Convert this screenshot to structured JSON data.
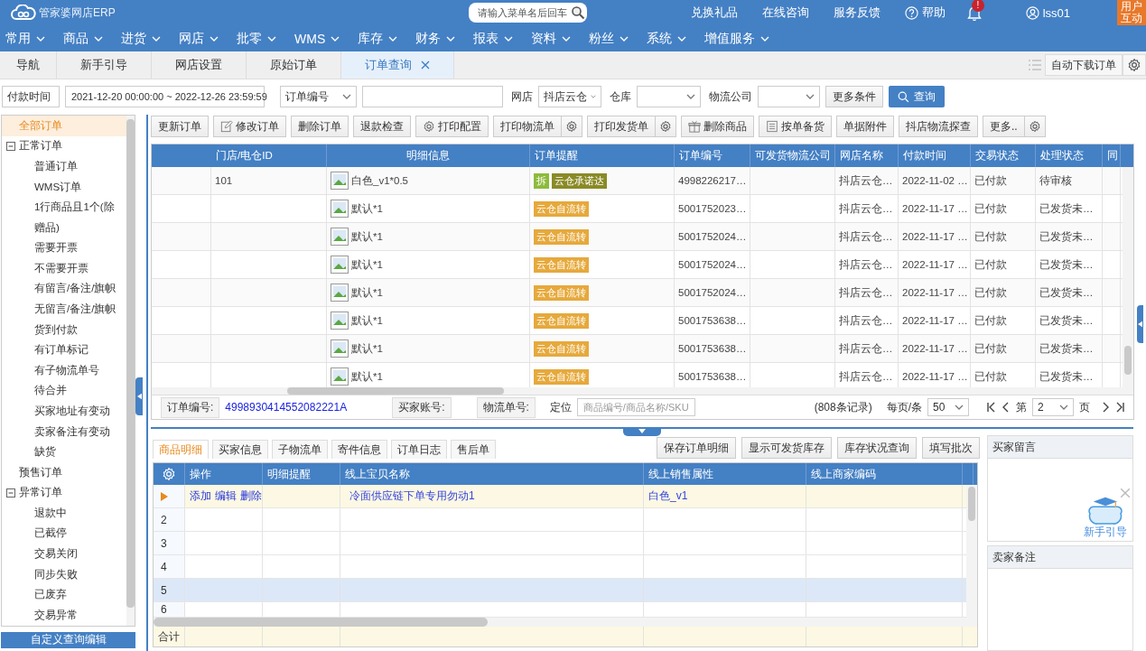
{
  "header": {
    "logo": "管家婆网店ERP",
    "search_placeholder": "请输入菜单名后回车",
    "links": [
      "兑换礼品",
      "在线咨询",
      "服务反馈"
    ],
    "help": "帮助",
    "notification_badge": "!",
    "user": "lss01",
    "user_interaction": "用户互动"
  },
  "menu": [
    "常用",
    "商品",
    "进货",
    "网店",
    "批零",
    "WMS",
    "库存",
    "财务",
    "报表",
    "资料",
    "粉丝",
    "系统",
    "增值服务"
  ],
  "tabs": [
    {
      "label": "导航",
      "selected": false,
      "closable": false
    },
    {
      "label": "新手引导",
      "selected": false,
      "closable": false
    },
    {
      "label": "网店设置",
      "selected": false,
      "closable": false
    },
    {
      "label": "原始订单",
      "selected": false,
      "closable": false
    },
    {
      "label": "订单查询",
      "selected": true,
      "closable": true
    }
  ],
  "auto_download": "自动下载订单",
  "filters": {
    "time_type": "付款时间",
    "date_range": "2021-12-20 00:00:00 ~ 2022-12-26 23:59:59",
    "order_field": "订单编号",
    "shop_label": "网店",
    "shop": "抖店云仓",
    "warehouse_label": "仓库",
    "logistics_label": "物流公司",
    "more_button": "更多条件",
    "search_button": "查询"
  },
  "sidebar": {
    "items": [
      {
        "label": "全部订单",
        "selected": true
      },
      {
        "label": "正常订单",
        "selected": false,
        "expanded": true,
        "children": [
          {
            "label": "普通订单",
            "selected": false
          },
          {
            "label": "WMS订单",
            "selected": false
          },
          {
            "label": "1行商品且1个(除赠品)",
            "selected": false
          },
          {
            "label": "需要开票",
            "selected": false
          },
          {
            "label": "不需要开票",
            "selected": false
          },
          {
            "label": "有留言/备注/旗帜",
            "selected": false
          },
          {
            "label": "无留言/备注/旗帜",
            "selected": false
          },
          {
            "label": "货到付款",
            "selected": false
          },
          {
            "label": "有订单标记",
            "selected": false
          },
          {
            "label": "有子物流单号",
            "selected": false
          },
          {
            "label": "待合并",
            "selected": false
          },
          {
            "label": "买家地址有变动",
            "selected": false
          },
          {
            "label": "卖家备注有变动",
            "selected": false
          },
          {
            "label": "缺货",
            "selected": false
          }
        ]
      },
      {
        "label": "预售订单",
        "selected": false
      },
      {
        "label": "异常订单",
        "selected": false,
        "expanded": true,
        "children": [
          {
            "label": "退款中",
            "selected": false
          },
          {
            "label": "已截停",
            "selected": false
          },
          {
            "label": "交易关闭",
            "selected": false
          },
          {
            "label": "同步失败",
            "selected": false
          },
          {
            "label": "已废弃",
            "selected": false
          },
          {
            "label": "交易异常",
            "selected": false
          }
        ]
      }
    ],
    "custom_query_button": "自定义查询编辑"
  },
  "toolbar": [
    {
      "label": "更新订单",
      "kind": "plain",
      "settings": false
    },
    {
      "label": "修改订单",
      "kind": "edit",
      "settings": false
    },
    {
      "label": "删除订单",
      "kind": "plain",
      "settings": false
    },
    {
      "label": "退款检查",
      "kind": "plain",
      "settings": false
    },
    {
      "label": "打印配置",
      "kind": "config",
      "settings": false
    },
    {
      "label": "打印物流单",
      "kind": "plain",
      "settings": true
    },
    {
      "label": "打印发货单",
      "kind": "plain",
      "settings": true
    },
    {
      "label": "删除商品",
      "kind": "remove",
      "settings": false
    },
    {
      "label": "按单备货",
      "kind": "stock",
      "settings": false
    },
    {
      "label": "单据附件",
      "kind": "plain",
      "settings": false
    },
    {
      "label": "抖店物流探查",
      "kind": "plain",
      "settings": false
    },
    {
      "label": "更多..",
      "kind": "plain",
      "settings": true
    }
  ],
  "orders": {
    "columns": [
      "门店/电仓ID",
      "明细信息",
      "订单提醒",
      "订单编号",
      "可发货物流公司",
      "网店名称",
      "付款时间",
      "交易状态",
      "处理状态",
      "同"
    ],
    "rows": [
      {
        "store_id": "101",
        "detail": "白色_v1*0.5",
        "tags": [
          {
            "label": "拆",
            "color": "#8dbb3c"
          },
          {
            "label": "云仓承诺达",
            "color": "#8a8a26"
          }
        ],
        "order_no": "4998226217…",
        "shop": "抖店云仓…",
        "paid_at": "2022-11-02 …",
        "trade_status": "已付款",
        "process_status": "待审核"
      },
      {
        "detail": "默认*1",
        "tags": [
          {
            "label": "云仓自流转",
            "color": "#e6a93c"
          }
        ],
        "order_no": "5001752023…",
        "shop": "抖店云仓…",
        "paid_at": "2022-11-17 …",
        "trade_status": "已付款",
        "process_status": "已发货未…"
      },
      {
        "detail": "默认*1",
        "tags": [
          {
            "label": "云仓自流转",
            "color": "#e6a93c"
          }
        ],
        "order_no": "5001752024…",
        "shop": "抖店云仓…",
        "paid_at": "2022-11-17 …",
        "trade_status": "已付款",
        "process_status": "已发货未…"
      },
      {
        "detail": "默认*1",
        "tags": [
          {
            "label": "云仓自流转",
            "color": "#e6a93c"
          }
        ],
        "order_no": "5001752024…",
        "shop": "抖店云仓…",
        "paid_at": "2022-11-17 …",
        "trade_status": "已付款",
        "process_status": "已发货未…"
      },
      {
        "detail": "默认*1",
        "tags": [
          {
            "label": "云仓自流转",
            "color": "#e6a93c"
          }
        ],
        "order_no": "5001752024…",
        "shop": "抖店云仓…",
        "paid_at": "2022-11-17 …",
        "trade_status": "已付款",
        "process_status": "已发货未…"
      },
      {
        "detail": "默认*1",
        "tags": [
          {
            "label": "云仓自流转",
            "color": "#e6a93c"
          }
        ],
        "order_no": "5001753638…",
        "shop": "抖店云仓…",
        "paid_at": "2022-11-17 …",
        "trade_status": "已付款",
        "process_status": "已发货未…"
      },
      {
        "detail": "默认*1",
        "tags": [
          {
            "label": "云仓自流转",
            "color": "#e6a93c"
          }
        ],
        "order_no": "5001753638…",
        "shop": "抖店云仓…",
        "paid_at": "2022-11-17 …",
        "trade_status": "已付款",
        "process_status": "已发货未…"
      },
      {
        "detail": "默认*1",
        "tags": [
          {
            "label": "云仓自流转",
            "color": "#e6a93c"
          }
        ],
        "order_no": "5001753638…",
        "shop": "抖店云仓…",
        "paid_at": "2022-11-17 …",
        "trade_status": "已付款",
        "process_status": "已发货未…"
      }
    ],
    "footer": {
      "order_no_label": "订单编号:",
      "order_no": "4998930414552082221A",
      "buyer_label": "买家账号:",
      "tracking_label": "物流单号:",
      "locate_label": "定位",
      "locate_placeholder": "商品编号/商品名称/SKU",
      "record_count": "(808条记录)",
      "per_page_label": "每页/条",
      "per_page": "50",
      "page_prefix": "第",
      "page": "2",
      "page_suffix": "页"
    }
  },
  "detail": {
    "tabs": [
      {
        "label": "商品明细",
        "selected": true
      },
      {
        "label": "买家信息",
        "selected": false
      },
      {
        "label": "子物流单",
        "selected": false
      },
      {
        "label": "寄件信息",
        "selected": false
      },
      {
        "label": "订单日志",
        "selected": false
      },
      {
        "label": "售后单",
        "selected": false
      }
    ],
    "actions": [
      "保存订单明细",
      "显示可发货库存",
      "库存状况查询",
      "填写批次"
    ],
    "columns": [
      "操作",
      "明细提醒",
      "线上宝贝名称",
      "线上销售属性",
      "线上商家编码"
    ],
    "rows": [
      {
        "current": true,
        "selected": false,
        "row_actions": [
          "添加",
          "编辑",
          "删除"
        ],
        "name": "冷面供应链下单专用勿动1",
        "attribute": "白色_v1"
      },
      {
        "number": "2",
        "current": false,
        "selected": false
      },
      {
        "number": "3",
        "current": false,
        "selected": false
      },
      {
        "number": "4",
        "current": false,
        "selected": false
      },
      {
        "number": "5",
        "current": false,
        "selected": true
      },
      {
        "number": "6",
        "current": false,
        "selected": false
      }
    ],
    "total_label": "合计"
  },
  "buyer_message": {
    "title": "买家留言"
  },
  "seller_note": {
    "title": "卖家备注"
  },
  "guide": {
    "label": "新手引导"
  }
}
